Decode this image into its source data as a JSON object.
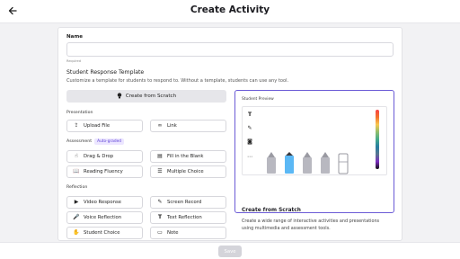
{
  "header": {
    "title": "Create Activity",
    "back_icon": "arrow-left-icon"
  },
  "form": {
    "name_label": "Name",
    "name_value": "",
    "required_text": "Required",
    "template_title": "Student Response Template",
    "template_desc": "Customize a template for students to respond to. Without a template, students can use any tool.",
    "scratch_label": "Create from Scratch",
    "presentation_label": "Presentation",
    "assessment_label": "Assessment",
    "assessment_badge": "Auto-graded",
    "reflection_label": "Reflection",
    "presentation": [
      {
        "label": "Upload File",
        "icon": "upload-icon"
      },
      {
        "label": "Link",
        "icon": "link-icon"
      }
    ],
    "assessment": [
      {
        "label": "Drag & Drop",
        "icon": "drag-icon"
      },
      {
        "label": "Fill in the Blank",
        "icon": "blank-icon"
      },
      {
        "label": "Reading Fluency",
        "icon": "book-icon"
      },
      {
        "label": "Multiple Choice",
        "icon": "list-icon"
      }
    ],
    "reflection": [
      {
        "label": "Video Response",
        "icon": "video-icon"
      },
      {
        "label": "Screen Record",
        "icon": "screen-record-icon"
      },
      {
        "label": "Voice Reflection",
        "icon": "mic-icon"
      },
      {
        "label": "Text Reflection",
        "icon": "text-icon"
      },
      {
        "label": "Student Choice",
        "icon": "choice-icon"
      },
      {
        "label": "Note",
        "icon": "note-icon"
      }
    ]
  },
  "preview": {
    "label": "Student Preview",
    "title": "Create from Scratch",
    "desc": "Create a wide range of interactive activities and presentations using multimedia and assessment tools."
  },
  "footer": {
    "save_label": "Save"
  },
  "colors": {
    "accent": "#6b5bd6",
    "selected_pen": "#5bb8f5"
  }
}
